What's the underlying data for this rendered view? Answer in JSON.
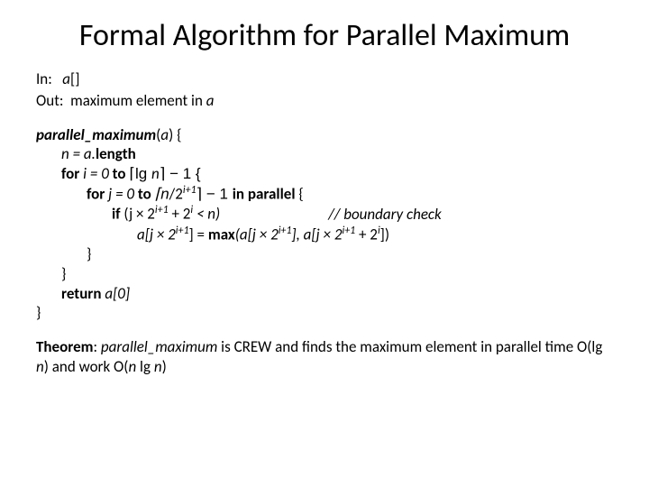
{
  "title": "Formal Algorithm for Parallel Maximum",
  "io": {
    "in_label": "In:",
    "in_val": "a",
    "in_suffix": "[]",
    "out_label": "Out:",
    "out_val": "maximum element in ",
    "out_var": "a"
  },
  "code": {
    "fn": "parallel_maximum",
    "fn_arg": "a",
    "fn_open": ") {",
    "l1_pre": "n = a.",
    "l1_len": "length",
    "l2_for": "for ",
    "l2_body": "i = 0 ",
    "l2_to": "to ",
    "l2_lg_pre": "⌈lg ",
    "l2_lg_n": "n",
    "l2_lg_post": "⌉ − 1 {",
    "l3_for": "for ",
    "l3_j": "j = 0 ",
    "l3_to": "to ",
    "l3_n": "⌈n",
    "l3_div": "/2",
    "l3_exp": "i+1",
    "l3_ceil": "⌉ − 1 ",
    "l3_inpar": "in parallel",
    "l3_brace": " {",
    "l4_if": "if ",
    "l4_cond_pre": "(j × 2",
    "l4_exp1": "i+1",
    "l4_mid": " + 2",
    "l4_exp2": "i",
    "l4_post": " < n)",
    "l4_comment": "// boundary check",
    "l5_pre": "a[j × 2",
    "l5_e1": "i+1",
    "l5_m1": "] = ",
    "l5_max": "max",
    "l5_m2": "(a[j × 2",
    "l5_e2": "i+1",
    "l5_m3": "], a[j × 2",
    "l5_e3": "i+1",
    "l5_m4": " + 2",
    "l5_e4": "i",
    "l5_m5": "])",
    "brace": "}",
    "ret": "return ",
    "ret_val": "a[0]"
  },
  "theorem": {
    "label": "Theorem",
    "t1": ": ",
    "fn": "parallel_maximum",
    "t2": " is CREW and finds the maximum element in parallel time O(lg ",
    "n1": "n",
    "t3": ") and work O(",
    "n2": "n",
    "t4": " lg ",
    "n3": "n",
    "t5": ")"
  }
}
